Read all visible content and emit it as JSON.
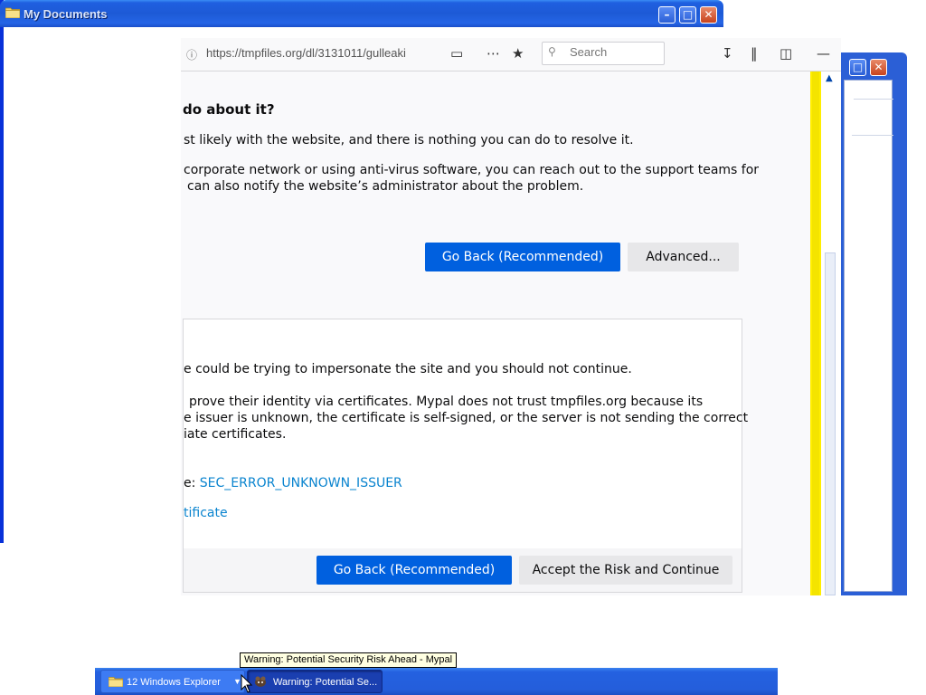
{
  "my_documents": {
    "title": "My Documents"
  },
  "browser": {
    "url": "https://tmpfiles.org/dl/3131011/gulleaki",
    "search_placeholder": "Search",
    "heading": "do about it?",
    "para1": "st likely with the website, and there is nothing you can do to resolve it.",
    "para2_line1": "corporate network or using anti-virus software, you can reach out to the support teams for",
    "para2_line2": "can also notify the website’s administrator about the problem.",
    "go_back_label": "Go Back (Recommended)",
    "advanced_label": "Advanced...",
    "advanced_panel": {
      "line1": "e could be trying to impersonate the site and you should not continue.",
      "line2": "prove their identity via certificates. Mypal does not trust tmpfiles.org because its",
      "line3": "e issuer is unknown, the certificate is self-signed, or the server is not sending the correct",
      "line4": "iate certificates.",
      "error_code_prefix": "e:",
      "error_code": "SEC_ERROR_UNKNOWN_ISSUER",
      "view_certificate": "tificate",
      "go_back_label": "Go Back (Recommended)",
      "accept_label": "Accept the Risk and Continue"
    }
  },
  "taskbar": {
    "explorer_label": "12 Windows Explorer",
    "mypal_label": "Warning: Potential Se...",
    "tooltip": "Warning: Potential Security Risk Ahead - Mypal"
  },
  "colors": {
    "xp_blue": "#245edb",
    "primary_button": "#0060df",
    "link": "#0a84cf",
    "scrollbar_yellow": "#ffee00"
  }
}
